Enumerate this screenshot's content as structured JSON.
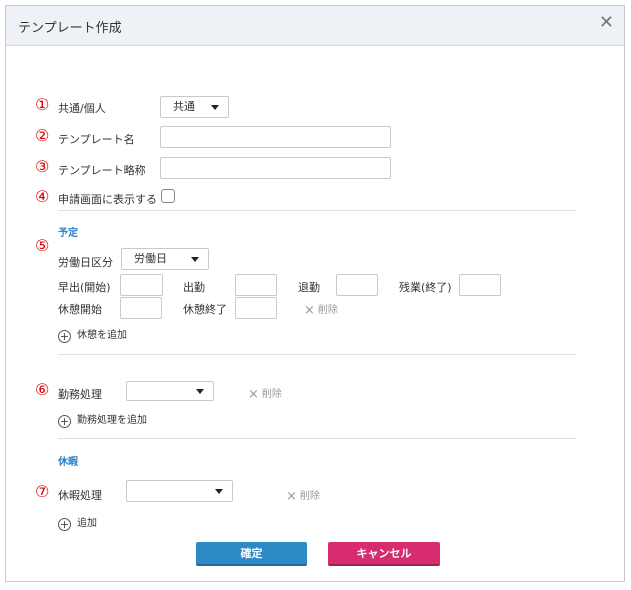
{
  "dialog": {
    "title": "テンプレート作成",
    "close_glyph": "✕"
  },
  "markers": [
    "①",
    "②",
    "③",
    "④",
    "⑤",
    "⑥",
    "⑦"
  ],
  "form": {
    "shared_label": "共通/個人",
    "shared_value": "共通",
    "template_name_label": "テンプレート名",
    "template_abbr_label": "テンプレート略称",
    "show_on_request_label": "申請画面に表示する"
  },
  "schedule": {
    "section_title": "予定",
    "workday_type_label": "労働日区分",
    "workday_type_value": "労働日",
    "early_start_label": "早出(開始)",
    "clock_in_label": "出勤",
    "clock_out_label": "退勤",
    "overtime_end_label": "残業(終了)",
    "break_start_label": "休憩開始",
    "break_end_label": "休憩終了",
    "delete_label": "削除",
    "add_break_label": "休憩を追加"
  },
  "work_processing": {
    "label": "勤務処理",
    "value": "",
    "delete_label": "削除",
    "add_label": "勤務処理を追加"
  },
  "leave": {
    "section_title": "休暇",
    "processing_label": "休暇処理",
    "value": "",
    "delete_label": "削除",
    "add_label": "追加"
  },
  "footer": {
    "confirm_label": "確定",
    "cancel_label": "キャンセル"
  },
  "colors": {
    "accent": "#2b7fc6",
    "confirm": "#2d8ac7",
    "cancel": "#d72d6f",
    "marker": "#dd0000"
  }
}
